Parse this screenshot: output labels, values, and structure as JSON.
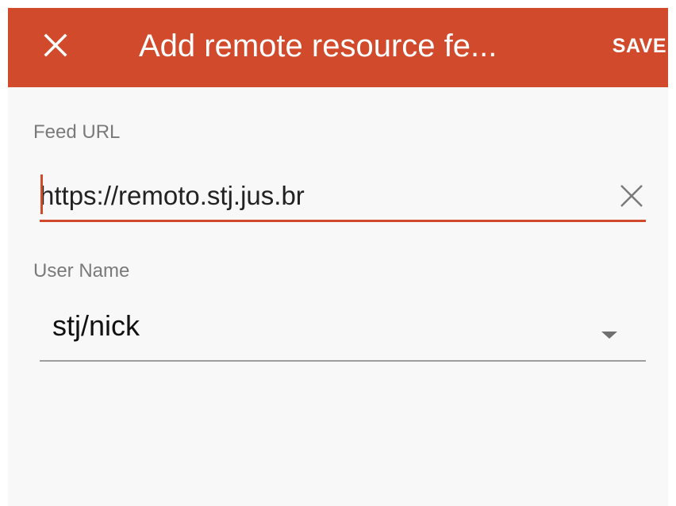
{
  "appbar": {
    "title": "Add remote resource fe...",
    "save_label": "SAVE",
    "close_icon": "close-icon",
    "color": "#d14a2b"
  },
  "form": {
    "feed_url": {
      "label": "Feed URL",
      "value": "https://remoto.stj.jus.br",
      "clear_icon": "clear-icon"
    },
    "user_name": {
      "label": "User Name",
      "value": "stj/nick",
      "dropdown_icon": "dropdown-arrow-icon"
    }
  },
  "colors": {
    "accent": "#d14a2b",
    "background": "#f8f8f8",
    "label": "#7a7a7a"
  }
}
